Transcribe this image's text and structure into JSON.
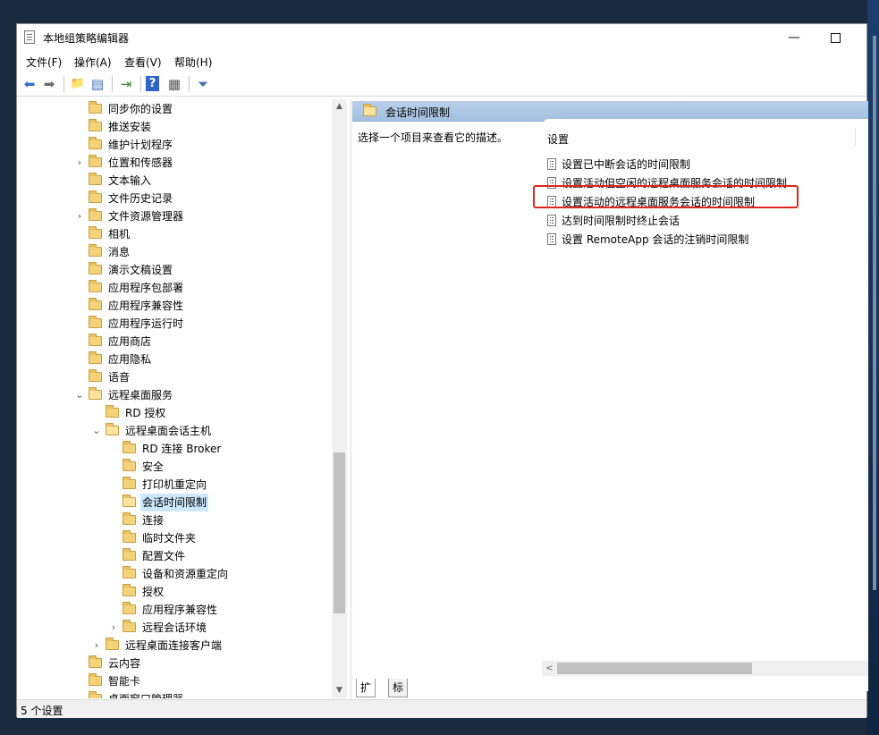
{
  "window": {
    "title": "本地组策略编辑器",
    "minimize_glyph": "—",
    "maximize_glyph": ""
  },
  "menu": [
    "文件(F)",
    "操作(A)",
    "查看(V)",
    "帮助(H)"
  ],
  "toolbar": {
    "back_glyph": "⬅",
    "forward_glyph": "➡",
    "up_glyph": "📁",
    "show_hide_glyph": "▤",
    "export_glyph": "⇥",
    "help_glyph": "?",
    "properties_glyph": "▦",
    "filter_glyph": "⏷"
  },
  "tree": {
    "items": [
      {
        "label": "同步你的设置",
        "level": 0,
        "expander": "",
        "open": false,
        "selected": false
      },
      {
        "label": "推送安装",
        "level": 0,
        "expander": "",
        "open": false,
        "selected": false
      },
      {
        "label": "维护计划程序",
        "level": 0,
        "expander": "",
        "open": false,
        "selected": false
      },
      {
        "label": "位置和传感器",
        "level": 0,
        "expander": ">",
        "open": false,
        "selected": false
      },
      {
        "label": "文本输入",
        "level": 0,
        "expander": "",
        "open": false,
        "selected": false
      },
      {
        "label": "文件历史记录",
        "level": 0,
        "expander": "",
        "open": false,
        "selected": false
      },
      {
        "label": "文件资源管理器",
        "level": 0,
        "expander": ">",
        "open": false,
        "selected": false
      },
      {
        "label": "相机",
        "level": 0,
        "expander": "",
        "open": false,
        "selected": false
      },
      {
        "label": "消息",
        "level": 0,
        "expander": "",
        "open": false,
        "selected": false
      },
      {
        "label": "演示文稿设置",
        "level": 0,
        "expander": "",
        "open": false,
        "selected": false
      },
      {
        "label": "应用程序包部署",
        "level": 0,
        "expander": "",
        "open": false,
        "selected": false
      },
      {
        "label": "应用程序兼容性",
        "level": 0,
        "expander": "",
        "open": false,
        "selected": false
      },
      {
        "label": "应用程序运行时",
        "level": 0,
        "expander": "",
        "open": false,
        "selected": false
      },
      {
        "label": "应用商店",
        "level": 0,
        "expander": "",
        "open": false,
        "selected": false
      },
      {
        "label": "应用隐私",
        "level": 0,
        "expander": "",
        "open": false,
        "selected": false
      },
      {
        "label": "语音",
        "level": 0,
        "expander": "",
        "open": false,
        "selected": false
      },
      {
        "label": "远程桌面服务",
        "level": 0,
        "expander": "v",
        "open": true,
        "selected": false
      },
      {
        "label": "RD 授权",
        "level": 1,
        "expander": "",
        "open": false,
        "selected": false
      },
      {
        "label": "远程桌面会话主机",
        "level": 1,
        "expander": "v",
        "open": true,
        "selected": false
      },
      {
        "label": "RD 连接 Broker",
        "level": 2,
        "expander": "",
        "open": false,
        "selected": false
      },
      {
        "label": "安全",
        "level": 2,
        "expander": "",
        "open": false,
        "selected": false
      },
      {
        "label": "打印机重定向",
        "level": 2,
        "expander": "",
        "open": false,
        "selected": false
      },
      {
        "label": "会话时间限制",
        "level": 2,
        "expander": "",
        "open": true,
        "selected": true
      },
      {
        "label": "连接",
        "level": 2,
        "expander": "",
        "open": false,
        "selected": false
      },
      {
        "label": "临时文件夹",
        "level": 2,
        "expander": "",
        "open": false,
        "selected": false
      },
      {
        "label": "配置文件",
        "level": 2,
        "expander": "",
        "open": false,
        "selected": false
      },
      {
        "label": "设备和资源重定向",
        "level": 2,
        "expander": "",
        "open": false,
        "selected": false
      },
      {
        "label": "授权",
        "level": 2,
        "expander": "",
        "open": false,
        "selected": false
      },
      {
        "label": "应用程序兼容性",
        "level": 2,
        "expander": "",
        "open": false,
        "selected": false
      },
      {
        "label": "远程会话环境",
        "level": 2,
        "expander": ">",
        "open": false,
        "selected": false
      },
      {
        "label": "远程桌面连接客户端",
        "level": 1,
        "expander": ">",
        "open": false,
        "selected": false
      },
      {
        "label": "云内容",
        "level": 0,
        "expander": "",
        "open": false,
        "selected": false
      },
      {
        "label": "智能卡",
        "level": 0,
        "expander": "",
        "open": false,
        "selected": false
      },
      {
        "label": "桌面窗口管理器",
        "level": 0,
        "expander": "",
        "open": false,
        "selected": false
      }
    ],
    "scroll_up_glyph": "▲",
    "scroll_down_glyph": "▼"
  },
  "details": {
    "header_title": "会话时间限制",
    "description": "选择一个项目来查看它的描述。",
    "column_header": "设置",
    "policies": [
      "设置已中断会话的时间限制",
      "设置活动但空闲的远程桌面服务会话的时间限制",
      "设置活动的远程桌面服务会话的时间限制",
      "达到时间限制时终止会话",
      "设置 RemoteApp 会话的注销时间限制"
    ],
    "highlight_color": "#e0261f",
    "hscroll_left_glyph": "<"
  },
  "tabs": [
    "扩展",
    "标准"
  ],
  "status": "5 个设置"
}
